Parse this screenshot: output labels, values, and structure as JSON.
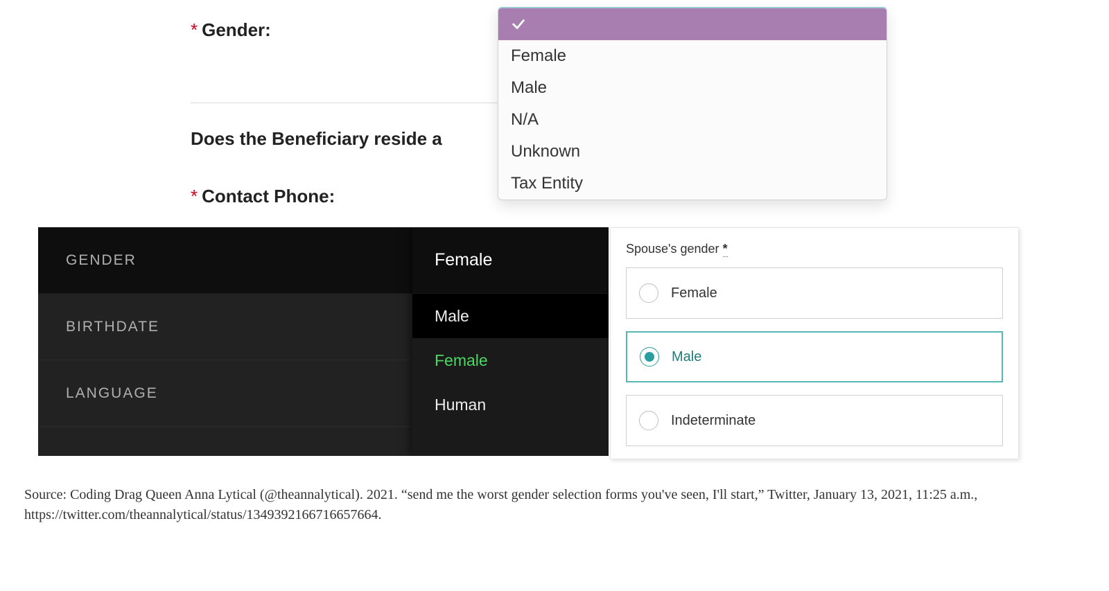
{
  "panelA": {
    "gender_label": "Gender:",
    "beneficiary_question": "Does the Beneficiary reside a",
    "phone_label": "Contact Phone:",
    "asterisk": "*",
    "dropdown_options": [
      "",
      "Female",
      "Male",
      "N/A",
      "Unknown",
      "Tax Entity"
    ]
  },
  "panelB": {
    "rows": [
      {
        "label": "GENDER",
        "value": "Female"
      },
      {
        "label": "BIRTHDATE",
        "value": ""
      },
      {
        "label": "LANGUAGE",
        "value": ""
      }
    ],
    "menu_header": "Female",
    "menu_options": [
      {
        "text": "Male",
        "highlight": true,
        "selected": false
      },
      {
        "text": "Female",
        "highlight": false,
        "selected": true
      },
      {
        "text": "Human",
        "highlight": false,
        "selected": false
      }
    ]
  },
  "panelC": {
    "title_prefix": "Spouse's gender",
    "required_mark": "*",
    "options": [
      {
        "label": "Female",
        "selected": false
      },
      {
        "label": "Male",
        "selected": true
      },
      {
        "label": "Indeterminate",
        "selected": false
      }
    ]
  },
  "caption": {
    "line1": "Source: Coding Drag Queen Anna Lytical (@theannalytical). 2021. “send me the worst gender selection forms you've seen, I'll start,” Twitter, January 13, 2021, 11:25 a.m.,",
    "line2": "https://twitter.com/theannalytical/status/1349392166716657664."
  }
}
